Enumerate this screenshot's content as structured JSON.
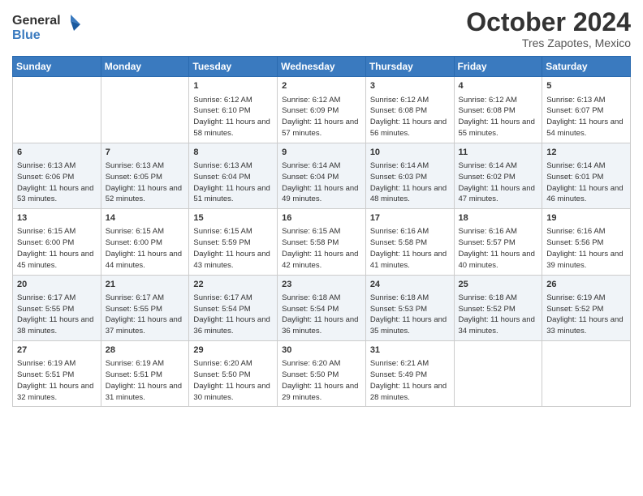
{
  "header": {
    "logo_general": "General",
    "logo_blue": "Blue",
    "month": "October 2024",
    "location": "Tres Zapotes, Mexico"
  },
  "weekdays": [
    "Sunday",
    "Monday",
    "Tuesday",
    "Wednesday",
    "Thursday",
    "Friday",
    "Saturday"
  ],
  "weeks": [
    [
      {
        "day": "",
        "info": ""
      },
      {
        "day": "",
        "info": ""
      },
      {
        "day": "1",
        "info": "Sunrise: 6:12 AM\nSunset: 6:10 PM\nDaylight: 11 hours and 58 minutes."
      },
      {
        "day": "2",
        "info": "Sunrise: 6:12 AM\nSunset: 6:09 PM\nDaylight: 11 hours and 57 minutes."
      },
      {
        "day": "3",
        "info": "Sunrise: 6:12 AM\nSunset: 6:08 PM\nDaylight: 11 hours and 56 minutes."
      },
      {
        "day": "4",
        "info": "Sunrise: 6:12 AM\nSunset: 6:08 PM\nDaylight: 11 hours and 55 minutes."
      },
      {
        "day": "5",
        "info": "Sunrise: 6:13 AM\nSunset: 6:07 PM\nDaylight: 11 hours and 54 minutes."
      }
    ],
    [
      {
        "day": "6",
        "info": "Sunrise: 6:13 AM\nSunset: 6:06 PM\nDaylight: 11 hours and 53 minutes."
      },
      {
        "day": "7",
        "info": "Sunrise: 6:13 AM\nSunset: 6:05 PM\nDaylight: 11 hours and 52 minutes."
      },
      {
        "day": "8",
        "info": "Sunrise: 6:13 AM\nSunset: 6:04 PM\nDaylight: 11 hours and 51 minutes."
      },
      {
        "day": "9",
        "info": "Sunrise: 6:14 AM\nSunset: 6:04 PM\nDaylight: 11 hours and 49 minutes."
      },
      {
        "day": "10",
        "info": "Sunrise: 6:14 AM\nSunset: 6:03 PM\nDaylight: 11 hours and 48 minutes."
      },
      {
        "day": "11",
        "info": "Sunrise: 6:14 AM\nSunset: 6:02 PM\nDaylight: 11 hours and 47 minutes."
      },
      {
        "day": "12",
        "info": "Sunrise: 6:14 AM\nSunset: 6:01 PM\nDaylight: 11 hours and 46 minutes."
      }
    ],
    [
      {
        "day": "13",
        "info": "Sunrise: 6:15 AM\nSunset: 6:00 PM\nDaylight: 11 hours and 45 minutes."
      },
      {
        "day": "14",
        "info": "Sunrise: 6:15 AM\nSunset: 6:00 PM\nDaylight: 11 hours and 44 minutes."
      },
      {
        "day": "15",
        "info": "Sunrise: 6:15 AM\nSunset: 5:59 PM\nDaylight: 11 hours and 43 minutes."
      },
      {
        "day": "16",
        "info": "Sunrise: 6:15 AM\nSunset: 5:58 PM\nDaylight: 11 hours and 42 minutes."
      },
      {
        "day": "17",
        "info": "Sunrise: 6:16 AM\nSunset: 5:58 PM\nDaylight: 11 hours and 41 minutes."
      },
      {
        "day": "18",
        "info": "Sunrise: 6:16 AM\nSunset: 5:57 PM\nDaylight: 11 hours and 40 minutes."
      },
      {
        "day": "19",
        "info": "Sunrise: 6:16 AM\nSunset: 5:56 PM\nDaylight: 11 hours and 39 minutes."
      }
    ],
    [
      {
        "day": "20",
        "info": "Sunrise: 6:17 AM\nSunset: 5:55 PM\nDaylight: 11 hours and 38 minutes."
      },
      {
        "day": "21",
        "info": "Sunrise: 6:17 AM\nSunset: 5:55 PM\nDaylight: 11 hours and 37 minutes."
      },
      {
        "day": "22",
        "info": "Sunrise: 6:17 AM\nSunset: 5:54 PM\nDaylight: 11 hours and 36 minutes."
      },
      {
        "day": "23",
        "info": "Sunrise: 6:18 AM\nSunset: 5:54 PM\nDaylight: 11 hours and 36 minutes."
      },
      {
        "day": "24",
        "info": "Sunrise: 6:18 AM\nSunset: 5:53 PM\nDaylight: 11 hours and 35 minutes."
      },
      {
        "day": "25",
        "info": "Sunrise: 6:18 AM\nSunset: 5:52 PM\nDaylight: 11 hours and 34 minutes."
      },
      {
        "day": "26",
        "info": "Sunrise: 6:19 AM\nSunset: 5:52 PM\nDaylight: 11 hours and 33 minutes."
      }
    ],
    [
      {
        "day": "27",
        "info": "Sunrise: 6:19 AM\nSunset: 5:51 PM\nDaylight: 11 hours and 32 minutes."
      },
      {
        "day": "28",
        "info": "Sunrise: 6:19 AM\nSunset: 5:51 PM\nDaylight: 11 hours and 31 minutes."
      },
      {
        "day": "29",
        "info": "Sunrise: 6:20 AM\nSunset: 5:50 PM\nDaylight: 11 hours and 30 minutes."
      },
      {
        "day": "30",
        "info": "Sunrise: 6:20 AM\nSunset: 5:50 PM\nDaylight: 11 hours and 29 minutes."
      },
      {
        "day": "31",
        "info": "Sunrise: 6:21 AM\nSunset: 5:49 PM\nDaylight: 11 hours and 28 minutes."
      },
      {
        "day": "",
        "info": ""
      },
      {
        "day": "",
        "info": ""
      }
    ]
  ]
}
